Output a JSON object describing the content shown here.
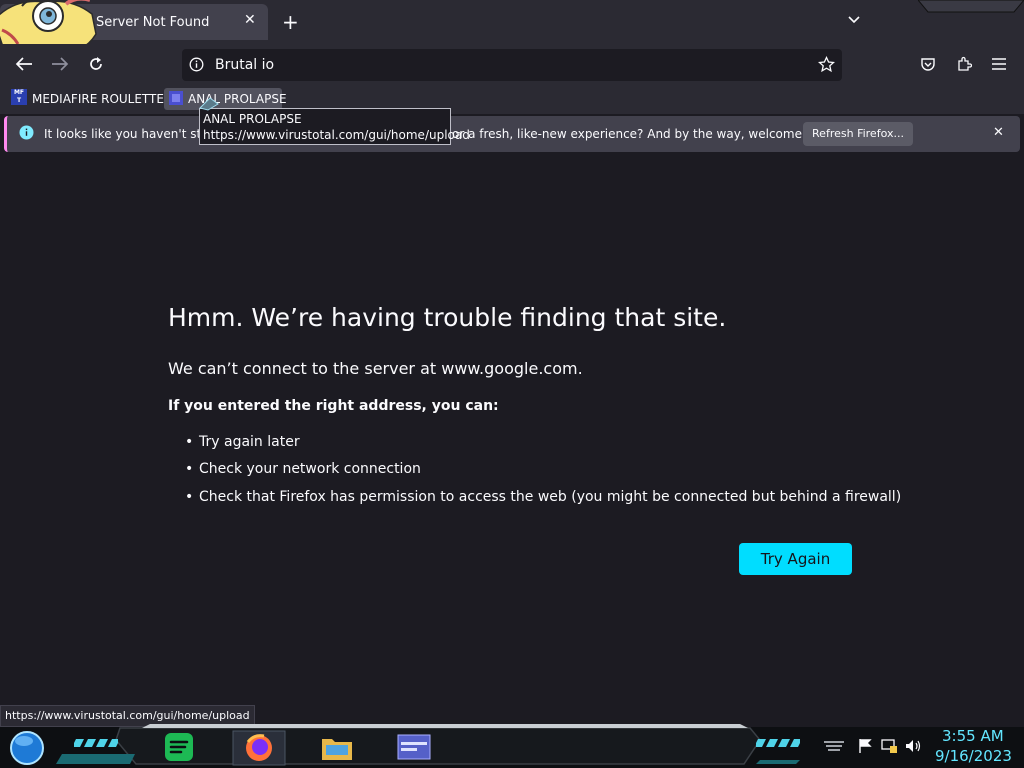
{
  "tab": {
    "title": "Server Not Found",
    "close": "✕",
    "new_tab": "+"
  },
  "toolbar": {
    "url": "Brutal io"
  },
  "bookmarks": [
    {
      "label": "MEDIAFIRE ROULETTER",
      "icon_text": "MF T"
    },
    {
      "label": "ANAL PROLAPSE"
    }
  ],
  "tooltip": {
    "title": "ANAL PROLAPSE",
    "url": "https://www.virustotal.com/gui/home/upload"
  },
  "notification": {
    "text_start": "It looks like you haven't starte",
    "text_end": "or a fresh, like-new experience? And by the way, welcome back!",
    "button": "Refresh Firefox...",
    "close": "✕"
  },
  "error": {
    "title": "Hmm. We’re having trouble finding that site.",
    "description": "We can’t connect to the server at www.google.com.",
    "subtitle": "If you entered the right address, you can:",
    "items": [
      "Try again later",
      "Check your network connection",
      "Check that Firefox has permission to access the web (you might be connected but behind a firewall)"
    ],
    "button": "Try Again"
  },
  "status_url": "https://www.virustotal.com/gui/home/upload",
  "taskbar": {
    "time": "3:55 AM",
    "date": "9/16/2023"
  },
  "colors": {
    "accent": "#00ddff",
    "clock": "#63e6ff",
    "background": "#1c1b22"
  }
}
